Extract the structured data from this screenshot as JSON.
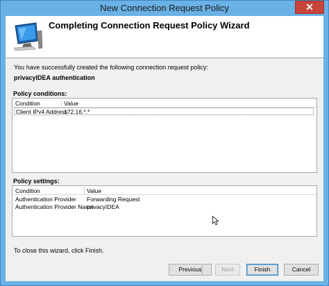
{
  "window": {
    "title": "New Connection Request Policy",
    "close_glyph": "✕"
  },
  "header": {
    "title": "Completing Connection Request Policy Wizard",
    "icon": "computer-monitor-icon"
  },
  "intro_text": "You have successfully created the following connection request policy:",
  "policy_name": "privacyIDEA authentication",
  "conditions": {
    "label": "Policy conditions:",
    "columns": [
      "Condition",
      "Value"
    ],
    "rows": [
      {
        "condition": "Client IPv4 Address",
        "value": "172.16.*.*"
      }
    ]
  },
  "settings": {
    "label": "Policy settings:",
    "columns": [
      "Condition",
      "Value"
    ],
    "rows": [
      {
        "condition": "Authentication Provider",
        "value": "Forwarding Request"
      },
      {
        "condition": "Authentication Provider Name",
        "value": "privacyIDEA"
      }
    ]
  },
  "footer_text": "To close this wizard, click Finish.",
  "buttons": {
    "previous": "Previous",
    "next": "Next",
    "finish": "Finish",
    "cancel": "Cancel"
  }
}
